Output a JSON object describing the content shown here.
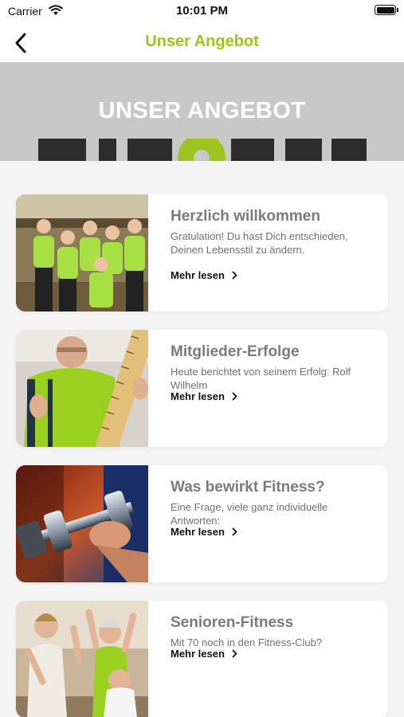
{
  "status_bar": {
    "carrier": "Carrier",
    "time": "10:01 PM"
  },
  "nav": {
    "title": "Unser Angebot"
  },
  "hero": {
    "title": "UNSER ANGEBOT",
    "logo_text": "FIT & FUN"
  },
  "colors": {
    "accent": "#9cc31e",
    "title_gray": "#7b7b7b",
    "text_gray": "#707070"
  },
  "articles": [
    {
      "title": "Herzlich willkommen",
      "description": "Gratulation! Du hast Dich entschieden, Deinen Lebensstil zu ändern.",
      "more": "Mehr lesen",
      "image": "team-photo"
    },
    {
      "title": "Mitglieder-Erfolge",
      "description": "Heute berichtet von seinem Erfolg: Rolf Wilhelm",
      "more": "Mehr lesen",
      "image": "member-success-photo"
    },
    {
      "title": "Was bewirkt Fitness?",
      "description": "Eine Frage, viele ganz individuelle Antworten:",
      "more": "Mehr lesen",
      "image": "dumbbell-photo"
    },
    {
      "title": "Senioren-Fitness",
      "description": "Mit 70 noch in den Fitness-Club?",
      "more": "Mehr lesen",
      "image": "seniors-photo"
    }
  ]
}
